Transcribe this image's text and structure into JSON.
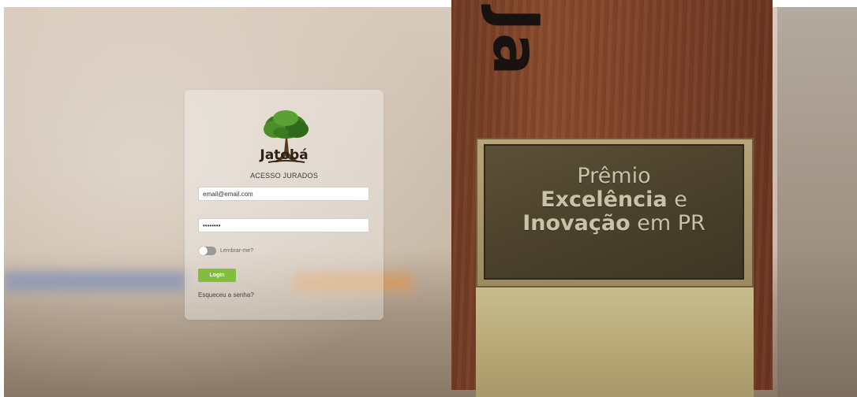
{
  "login": {
    "logo_text": "Jatobá",
    "subtitle": "ACESSO JURADOS",
    "email_value": "email@email.com",
    "password_value": "••••••••",
    "remember_label": "Lembrar-me?",
    "login_label": "Login",
    "forgot_label": "Esqueceu a senha?"
  },
  "background": {
    "plaque_line1": "Prêmio",
    "plaque_line2_bold": "Excelência",
    "plaque_line2_rest": " e",
    "plaque_line3_bold": "Inovação",
    "plaque_line3_rest": " em PR",
    "wood_letters": "Ja"
  },
  "colors": {
    "login_button": "#82be3d",
    "toggle_off": "#9a9a9a"
  }
}
